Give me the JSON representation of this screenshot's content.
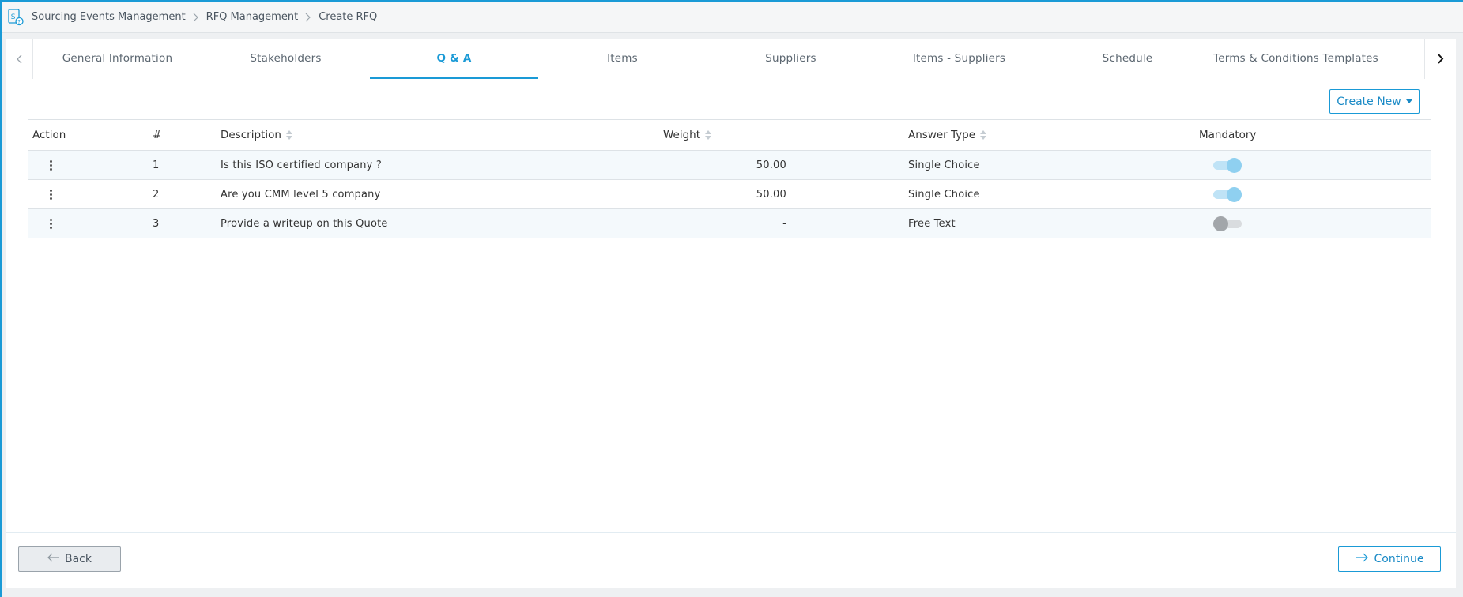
{
  "breadcrumb": {
    "items": [
      "Sourcing Events Management",
      "RFQ Management",
      "Create RFQ"
    ]
  },
  "tabs": [
    {
      "label": "General Information",
      "active": false
    },
    {
      "label": "Stakeholders",
      "active": false
    },
    {
      "label": "Q & A",
      "active": true
    },
    {
      "label": "Items",
      "active": false
    },
    {
      "label": "Suppliers",
      "active": false
    },
    {
      "label": "Items - Suppliers",
      "active": false
    },
    {
      "label": "Schedule",
      "active": false
    },
    {
      "label": "Terms & Conditions Templates",
      "active": false
    }
  ],
  "toolbar": {
    "create_new_label": "Create New"
  },
  "table": {
    "columns": {
      "action": "Action",
      "num": "#",
      "description": "Description",
      "weight": "Weight",
      "answer_type": "Answer Type",
      "mandatory": "Mandatory"
    },
    "rows": [
      {
        "num": "1",
        "description": "Is this ISO certified company ?",
        "weight": "50.00",
        "answer_type": "Single Choice",
        "mandatory": true
      },
      {
        "num": "2",
        "description": "Are you CMM level 5 company",
        "weight": "50.00",
        "answer_type": "Single Choice",
        "mandatory": true
      },
      {
        "num": "3",
        "description": "Provide a writeup on this Quote",
        "weight": "-",
        "answer_type": "Free Text",
        "mandatory": false
      }
    ]
  },
  "footer": {
    "back_label": "Back",
    "continue_label": "Continue"
  },
  "colors": {
    "accent": "#1a9ad6",
    "toggle_on": "#8fd0f0",
    "toggle_off": "#a2a6aa"
  },
  "icons": [
    "app-sourcing-icon",
    "chevron-right-icon",
    "chevron-left-icon",
    "kebab-icon",
    "arrow-left-icon",
    "arrow-right-icon",
    "caret-down-icon",
    "sort-icon"
  ]
}
